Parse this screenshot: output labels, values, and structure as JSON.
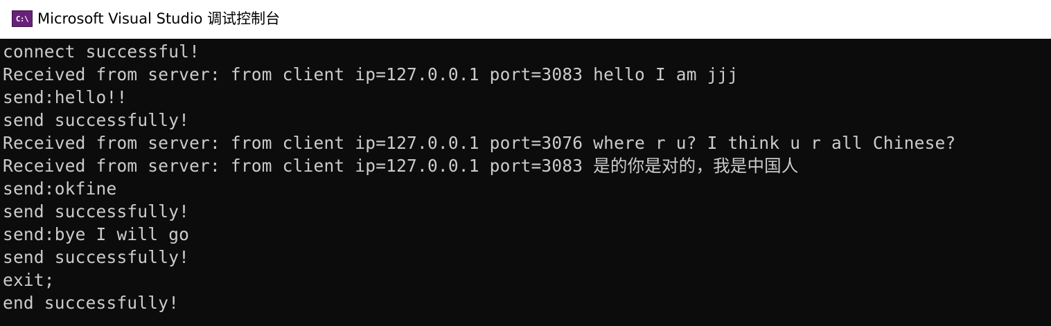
{
  "window": {
    "title": "Microsoft Visual Studio 调试控制台",
    "icon": "visual-studio-console-icon",
    "icon_text": "C:\\"
  },
  "colors": {
    "titlebar_bg": "#ffffff",
    "console_bg": "#0c0c0c",
    "console_text": "#cccccc",
    "icon_bg": "#68217a"
  },
  "console": {
    "lines": [
      "connect successful!",
      "Received from server: from client ip=127.0.0.1 port=3083 hello I am jjj",
      "send:hello!!",
      "send successfully!",
      "Received from server: from client ip=127.0.0.1 port=3076 where r u? I think u r all Chinese?",
      "Received from server: from client ip=127.0.0.1 port=3083 是的你是对的，我是中国人",
      "send:okfine",
      "send successfully!",
      "send:bye I will go",
      "send successfully!",
      "exit;",
      "end successfully!"
    ]
  }
}
